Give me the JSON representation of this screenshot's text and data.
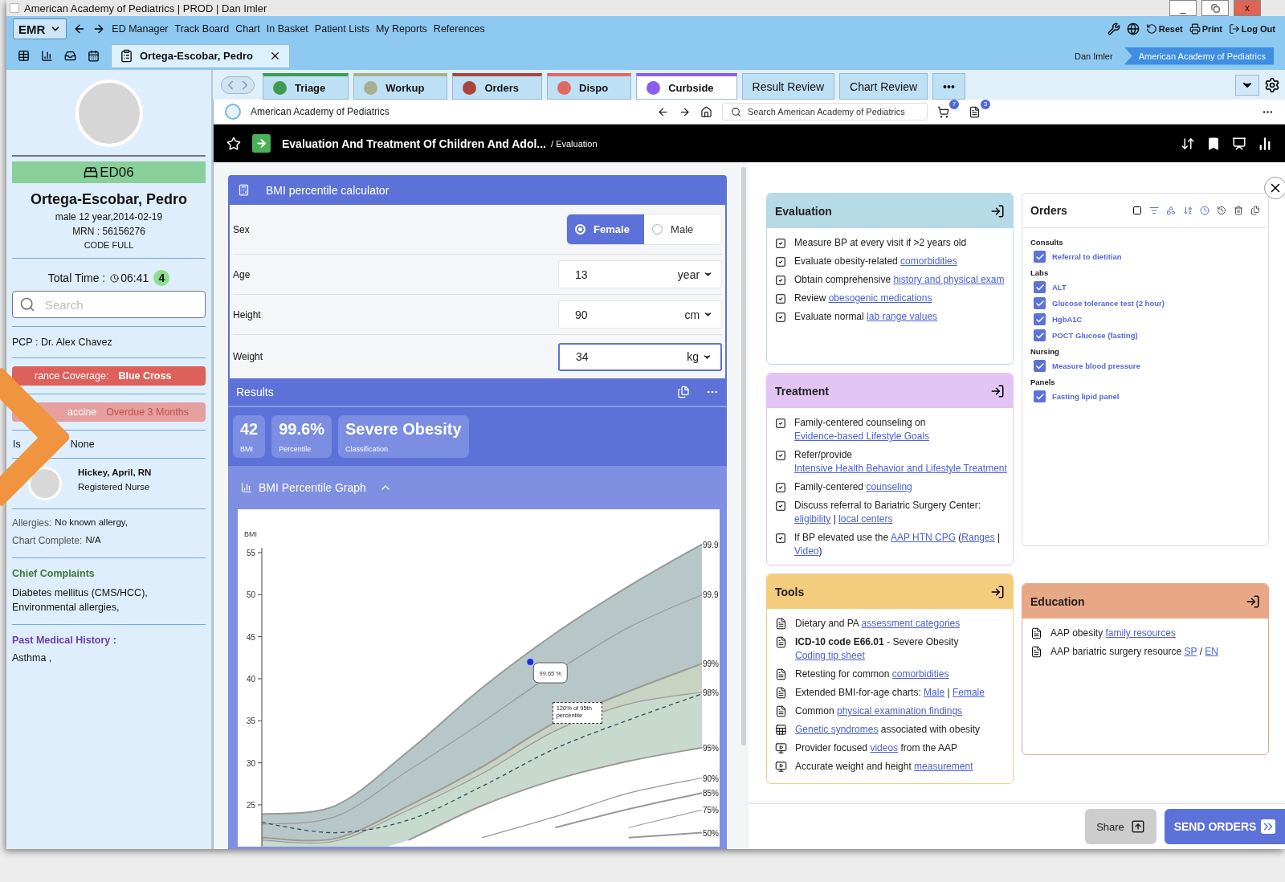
{
  "window": {
    "title": "American Academy of Pediatrics | PROD | Dan Imler",
    "minimize": "_",
    "close": "x"
  },
  "app_bar": {
    "menu_button": "EMR",
    "menu": [
      "ED Manager",
      "Track Board",
      "Chart",
      "In Basket",
      "Patient Lists",
      "My Reports",
      "References"
    ],
    "actions": [
      "Reset",
      "Print",
      "Log Out"
    ],
    "patient_tab": "Ortega-Escobar, Pedro",
    "user": "Dan Imler",
    "breadcrumb": "American Academy of Pediatrics"
  },
  "sidebar": {
    "room": "ED06",
    "name": "Ortega-Escobar, Pedro",
    "demographics": "male 12 year,2014-02-19",
    "mrn": "MRN : 56156276",
    "code": "CODE FULL",
    "total_time_label": "Total Time :",
    "total_time": "06:41",
    "count": "4",
    "search_placeholder": "Search",
    "pcp": "PCP : Dr. Alex Chavez",
    "alerts": [
      {
        "kind": "insurance",
        "label": "rance Coverage:",
        "value": "Blue Cross"
      },
      {
        "kind": "vaccine",
        "label": "accine",
        "value": "Overdue 3 Months"
      }
    ],
    "isolation": {
      "label": "Is",
      "value": "None"
    },
    "nurse": {
      "name": "Hickey, April, RN",
      "role": "Registered Nurse"
    },
    "facts": [
      {
        "label": "Allergies:",
        "value": "No known allergy,"
      },
      {
        "label": "Chart Complete:",
        "value": "N/A"
      }
    ],
    "chief_complaints": {
      "title": "Chief Complaints",
      "text": "Diabetes mellitus (CMS/HCC), Environmental allergies,"
    },
    "history": {
      "title": "Past Medical History :",
      "text": "Asthma ,"
    }
  },
  "tabs": [
    {
      "kind": "status",
      "label": "Triage",
      "color": "#3e9a50",
      "selected": false
    },
    {
      "kind": "status",
      "label": "Workup",
      "color": "#a9ae8c",
      "selected": false
    },
    {
      "kind": "status",
      "label": "Orders",
      "color": "#a8443d",
      "selected": false
    },
    {
      "kind": "status",
      "label": "Dispo",
      "color": "#e06862",
      "selected": false
    },
    {
      "kind": "status",
      "label": "Curbside",
      "color": "#8b5cf0",
      "selected": true
    },
    {
      "kind": "plain",
      "label": "Result Review",
      "selected": false
    },
    {
      "kind": "plain",
      "label": "Chart Review",
      "selected": false
    },
    {
      "kind": "more",
      "label": "•••",
      "selected": false
    }
  ],
  "browser": {
    "site": "American Academy of Pediatrics",
    "search_placeholder": "Search American Academy of Pediatrics",
    "cart_count": "7",
    "doc_count": "3"
  },
  "header": {
    "title": "Evaluation And Treatment Of Children And Adol...",
    "crumb": "/ Evaluation"
  },
  "calculator": {
    "title": "BMI percentile calculator",
    "fields": [
      {
        "kind": "choice",
        "label": "Sex",
        "options": [
          {
            "label": "Female",
            "selected": true
          },
          {
            "label": "Male",
            "selected": false
          }
        ]
      },
      {
        "kind": "input",
        "label": "Age",
        "value": "13",
        "unit": "year",
        "focused": false
      },
      {
        "kind": "input",
        "label": "Height",
        "value": "90",
        "unit": "cm",
        "focused": false
      },
      {
        "kind": "input",
        "label": "Weight",
        "value": "34",
        "unit": "kg",
        "focused": true
      }
    ]
  },
  "results": {
    "title": "Results",
    "stats": [
      {
        "value": "42",
        "label": "BMI"
      },
      {
        "value": "99.6%",
        "label": "Percentile"
      },
      {
        "value": "Severe Obesity",
        "label": "Classification"
      }
    ]
  },
  "graph": {
    "title": "BMI Percentile Graph",
    "expanded": true,
    "axis_label": "BMI",
    "ticks": [
      "55",
      "50",
      "45",
      "40",
      "35",
      "30",
      "25"
    ],
    "curve_labels": [
      "99.9",
      "99.9",
      "99%",
      "98%",
      "95%",
      "90%",
      "85%",
      "75%",
      "50%"
    ],
    "point_label": "99.65 %",
    "note": "120% of 95th percentile"
  },
  "evaluation": {
    "title": "Evaluation",
    "items": [
      {
        "checked": true,
        "parts": [
          {
            "text": "Measure BP at every visit if >2 years old"
          }
        ]
      },
      {
        "checked": true,
        "parts": [
          {
            "text": "Evaluate obesity-related "
          },
          {
            "text": "comorbidities",
            "link": true
          }
        ]
      },
      {
        "checked": true,
        "parts": [
          {
            "text": "Obtain comprehensive "
          },
          {
            "text": "history and physical exam",
            "link": true
          }
        ]
      },
      {
        "checked": true,
        "parts": [
          {
            "text": "Review "
          },
          {
            "text": "obesogenic medications",
            "link": true
          }
        ]
      },
      {
        "checked": true,
        "parts": [
          {
            "text": "Evaluate normal "
          },
          {
            "text": "lab range values",
            "link": true
          }
        ]
      }
    ]
  },
  "treatment": {
    "title": "Treatment",
    "items": [
      {
        "checked": true,
        "parts": [
          {
            "text": "Family-centered counseling on "
          },
          {
            "text": "Evidence-based Lifestyle Goals",
            "link": true
          }
        ]
      },
      {
        "checked": true,
        "parts": [
          {
            "text": "Refer/provide "
          },
          {
            "text": "Intensive Health Behavior and Lifestyle Treatment",
            "link": true
          }
        ]
      },
      {
        "checked": true,
        "parts": [
          {
            "text": "Family-centered "
          },
          {
            "text": "counseling",
            "link": true
          }
        ]
      },
      {
        "checked": true,
        "parts": [
          {
            "text": "Discuss referral to Bariatric Surgery Center: "
          },
          {
            "text": "eligibility",
            "link": true
          },
          {
            "text": " | "
          },
          {
            "text": "local centers",
            "link": true
          }
        ]
      },
      {
        "checked": true,
        "parts": [
          {
            "text": "If BP elevated use the "
          },
          {
            "text": "AAP HTN CPG",
            "link": true
          },
          {
            "text": " ("
          },
          {
            "text": "Ranges",
            "link": true
          },
          {
            "text": " | "
          },
          {
            "text": "Video",
            "link": true
          },
          {
            "text": ")"
          }
        ]
      }
    ]
  },
  "tools": {
    "title": "Tools",
    "items": [
      {
        "kind": "document",
        "parts": [
          {
            "text": "Dietary and PA "
          },
          {
            "text": "assessment categories",
            "link": true
          }
        ]
      },
      {
        "kind": "document",
        "parts": [
          {
            "text": "**ICD-10 code E66.01** - Severe Obesity "
          },
          {
            "text": "Coding tip sheet",
            "link": true
          }
        ]
      },
      {
        "kind": "document",
        "parts": [
          {
            "text": "Retesting for common "
          },
          {
            "text": "comorbidities",
            "link": true
          }
        ]
      },
      {
        "kind": "document",
        "parts": [
          {
            "text": "Extended BMI-for-age charts: "
          },
          {
            "text": "Male",
            "link": true
          },
          {
            "text": " | "
          },
          {
            "text": "Female",
            "link": true
          }
        ]
      },
      {
        "kind": "document",
        "parts": [
          {
            "text": "Common "
          },
          {
            "text": "physical examination findings",
            "link": true
          }
        ]
      },
      {
        "kind": "table",
        "parts": [
          {
            "text": "Genetic syndromes",
            "link": true
          },
          {
            "text": " associated with obesity"
          }
        ]
      },
      {
        "kind": "video",
        "parts": [
          {
            "text": "Provider focused "
          },
          {
            "text": "videos",
            "link": true
          },
          {
            "text": " from the AAP"
          }
        ]
      },
      {
        "kind": "video",
        "parts": [
          {
            "text": "Accurate weight and height "
          },
          {
            "text": "measurement",
            "link": true
          }
        ]
      }
    ]
  },
  "orders": {
    "title": "Orders",
    "groups": [
      {
        "name": "Consults",
        "items": [
          {
            "label": "Referral to dietitian",
            "checked": true
          }
        ]
      },
      {
        "name": "Labs",
        "items": [
          {
            "label": "ALT",
            "checked": true
          },
          {
            "label": "Glucose tolerance test (2 hour)",
            "checked": true
          },
          {
            "label": "HgbA1C",
            "checked": true
          },
          {
            "label": "POCT Glucose (fasting)",
            "checked": true
          }
        ]
      },
      {
        "name": "Nursing",
        "items": [
          {
            "label": "Measure blood pressure",
            "checked": true
          }
        ]
      },
      {
        "name": "Panels",
        "items": [
          {
            "label": "Fasting lipid panel",
            "checked": true
          }
        ]
      }
    ]
  },
  "education": {
    "title": "Education",
    "items": [
      {
        "kind": "document",
        "parts": [
          {
            "text": "AAP obesity "
          },
          {
            "text": "family resources",
            "link": true
          }
        ]
      },
      {
        "kind": "document",
        "parts": [
          {
            "text": "AAP bariatric surgery resource "
          },
          {
            "text": "SP",
            "link": true
          },
          {
            "text": " / "
          },
          {
            "text": "EN",
            "link": true
          }
        ]
      }
    ]
  },
  "footer": {
    "share": "Share",
    "send": "SEND ORDERS"
  }
}
